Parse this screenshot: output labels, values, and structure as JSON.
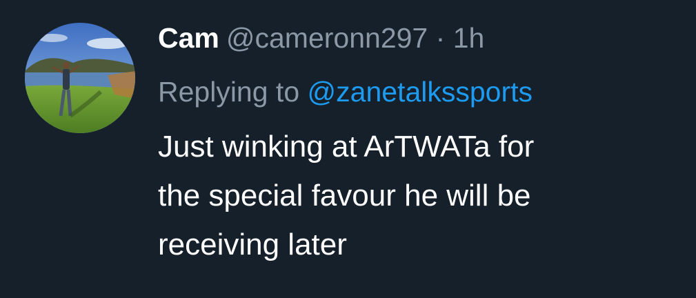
{
  "tweet": {
    "author_name": "Cam",
    "author_handle": "@cameronn297",
    "separator": "·",
    "time": "1h",
    "replying_label": "Replying to",
    "replying_to": "@zanetalkssports",
    "body_lines": [
      "Just winking at ArTWATa for",
      "the special favour he will be",
      "receiving later"
    ]
  },
  "colors": {
    "background": "#15202b",
    "text_primary": "#ffffff",
    "text_secondary": "#8b98a5",
    "link": "#1d9bf0"
  },
  "icons": {
    "avatar": "profile-photo"
  }
}
